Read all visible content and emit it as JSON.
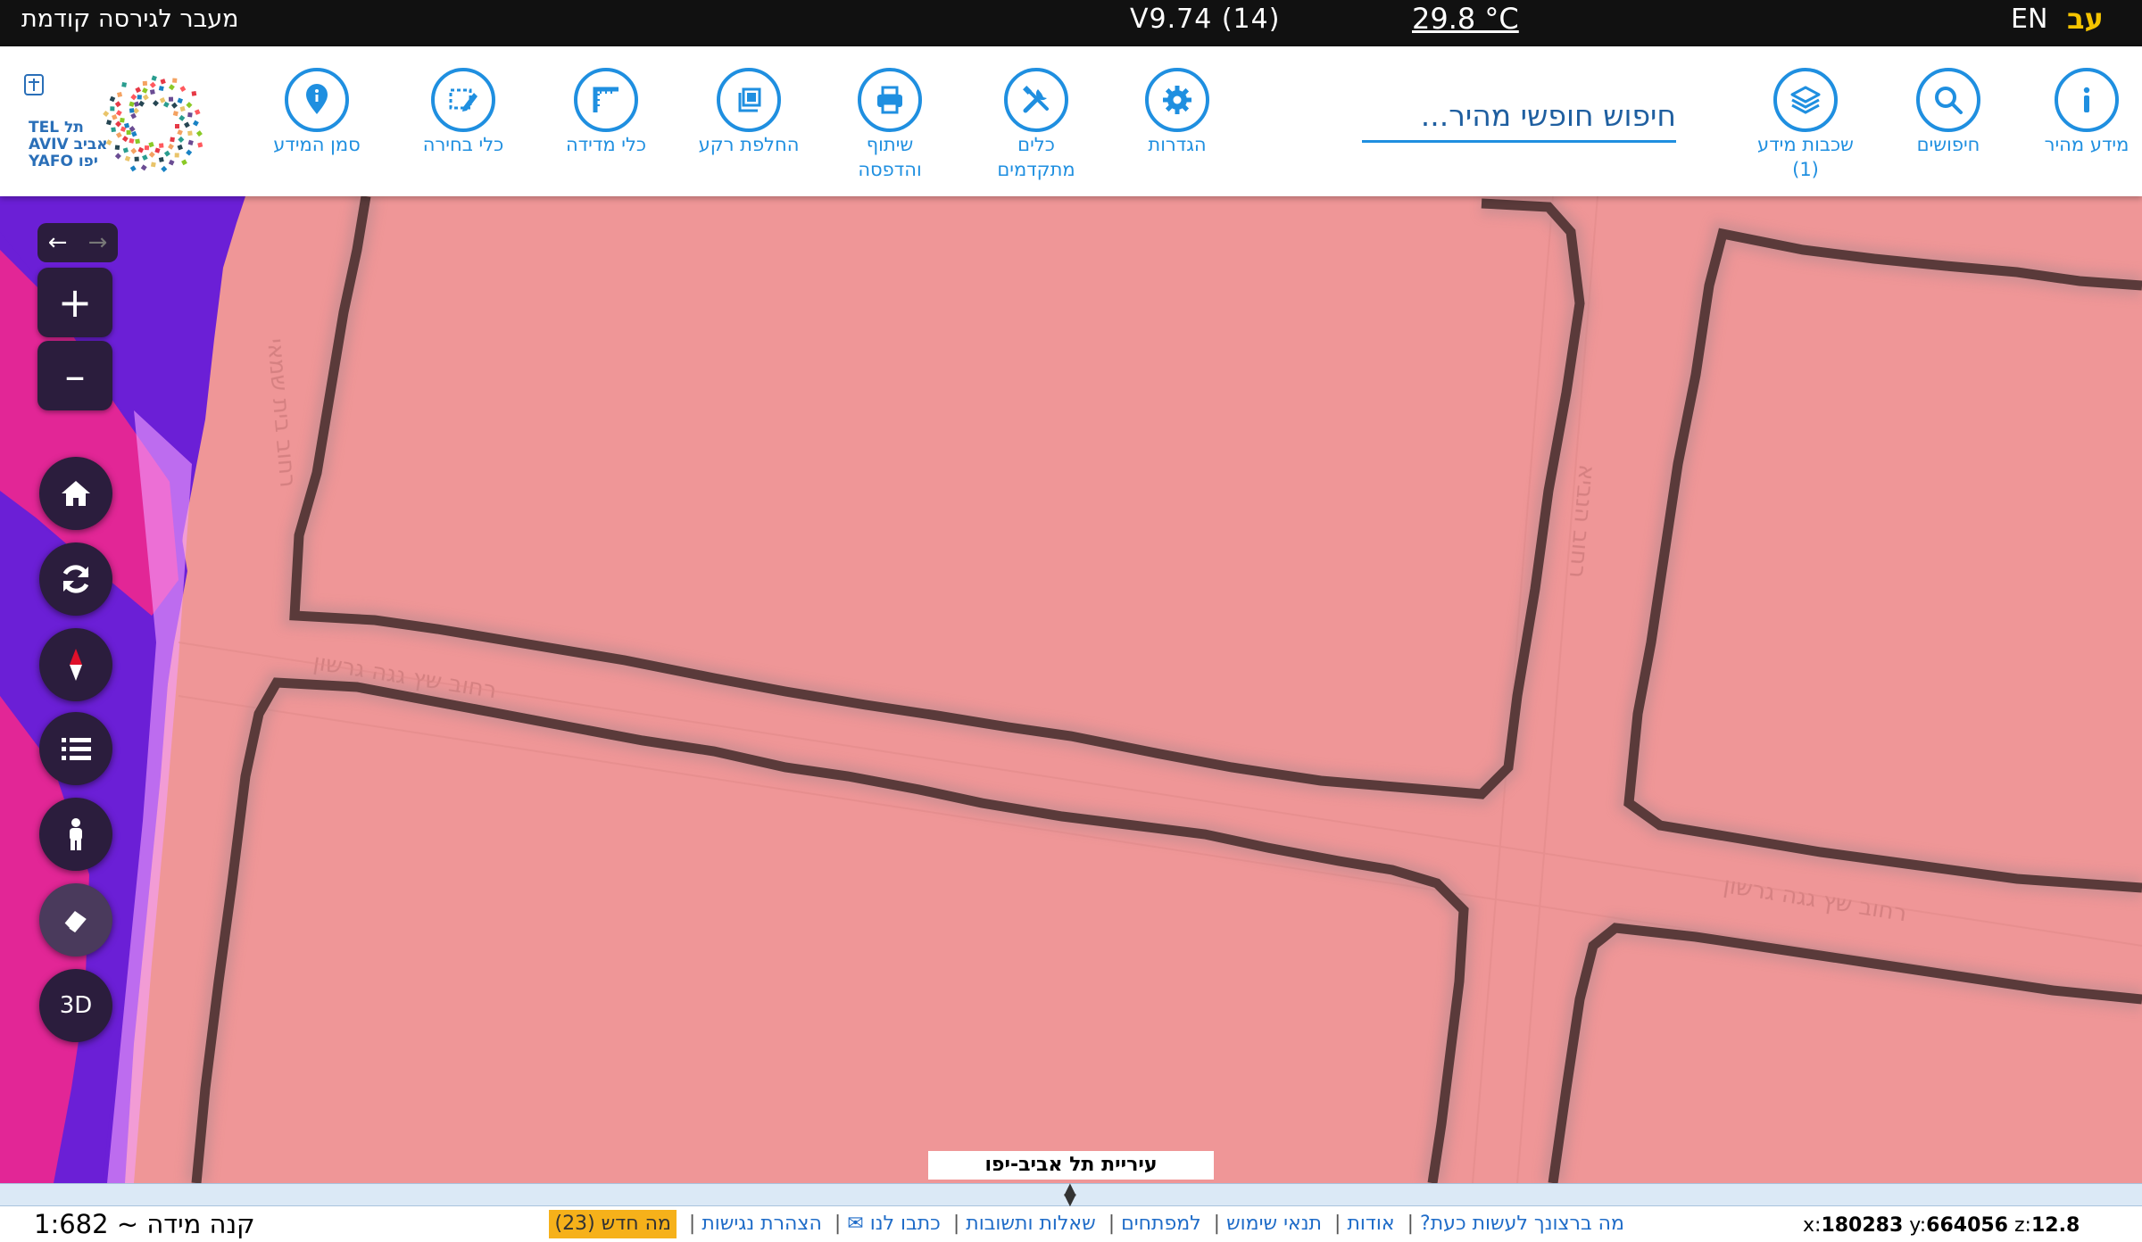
{
  "topbar": {
    "prev_version": "מעבר לגירסה קודמת",
    "version": "V9.74 (14)",
    "weather": "29.8 °C",
    "lang_en": "EN",
    "lang_he": "עב"
  },
  "logo": {
    "text_line1": "TEL תל",
    "text_line2": "AVIV אביב",
    "text_line3": "YAFO יפו"
  },
  "toolbar": {
    "tools": [
      {
        "id": "quick-info",
        "label": "מידע מהיר",
        "icon": "info-icon"
      },
      {
        "id": "searches",
        "label": "חיפושים",
        "icon": "search-icon"
      },
      {
        "id": "info-layers",
        "label": "שכבות מידע",
        "sublabel": "(1)",
        "icon": "layers-icon"
      },
      {
        "id": "settings",
        "label": "הגדרות",
        "icon": "gear-icon"
      },
      {
        "id": "advanced-tools",
        "label": "כלים",
        "sublabel": "מתקדמים",
        "icon": "tools-icon"
      },
      {
        "id": "share-print",
        "label": "שיתוף",
        "sublabel": "והדפסה",
        "icon": "printer-icon"
      },
      {
        "id": "basemap",
        "label": "החלפת רקע",
        "icon": "basemap-icon"
      },
      {
        "id": "measure",
        "label": "כלי מדידה",
        "icon": "ruler-icon"
      },
      {
        "id": "selection",
        "label": "כלי בחירה",
        "icon": "selection-icon"
      },
      {
        "id": "info-marker",
        "label": "סמן המידע",
        "icon": "map-pin-icon"
      }
    ],
    "search_placeholder": "חיפוש חופשי מהיר..."
  },
  "map": {
    "city_label": "עיריית תל אביב-יפו",
    "colors": {
      "base": "#ef9697",
      "parcel_line": "#5a3a3a",
      "purple": "#6b1fd6",
      "magenta": "#f0278f"
    }
  },
  "map_controls": {
    "history_back_icon": "arrow-left-icon",
    "history_forward_icon": "arrow-right-icon",
    "zoom_in": "+",
    "zoom_out": "–",
    "three_d": "3D"
  },
  "bottom": {
    "scale_text": "קנה מידה ~ 1:682",
    "links": [
      "מה ברצונך לעשות כעת?",
      "אודות",
      "תנאי שימוש",
      "למפתחים",
      "שאלות ותשובות",
      "כתבו לנו ✉",
      "הצהרת נגישות"
    ],
    "news_label": "מה חדש (23)",
    "coords": {
      "x_label": "x:",
      "x": "180283",
      "y_label": "y:",
      "y": "664056",
      "z_label": "z:",
      "z": "12.8"
    }
  }
}
